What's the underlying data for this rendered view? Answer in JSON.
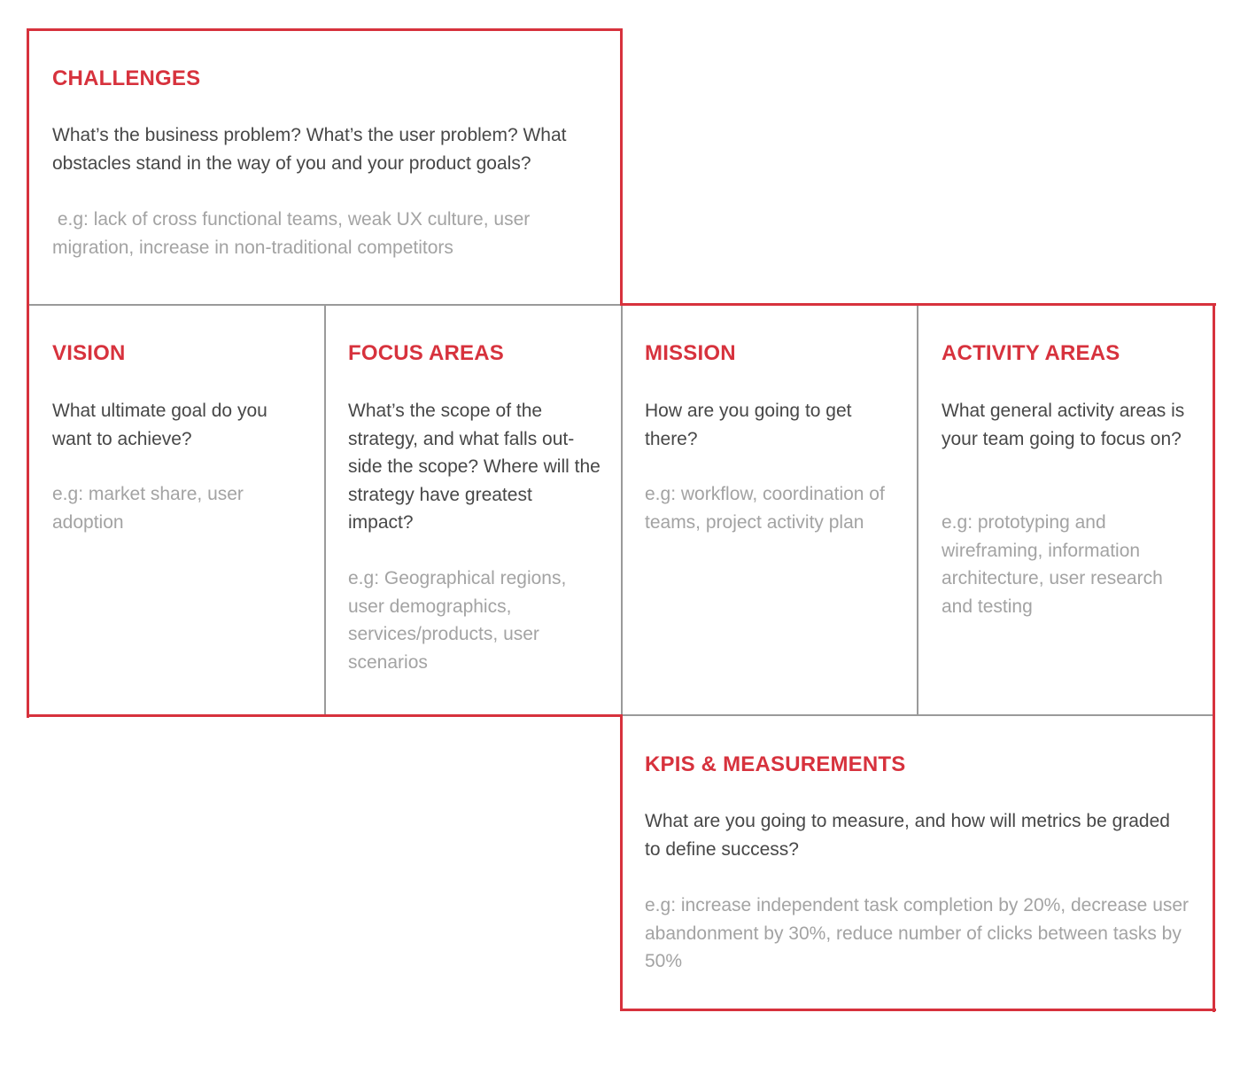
{
  "canvas": {
    "colors": {
      "accent_red": "#d7323d",
      "divider_gray": "#9a9a9a",
      "question_text": "#474747",
      "example_text": "#a3a3a3"
    },
    "sections": {
      "challenges": {
        "title": "CHALLENGES",
        "question": "What’s the business problem? What’s the user problem? What obstacles stand in the way of you and your product goals?",
        "example": " e.g: lack of cross functional teams, weak UX culture, user migration, increase in non-traditional competitors"
      },
      "vision": {
        "title": "VISION",
        "question": "What ultimate goal do you want to achieve?",
        "example": "e.g: market share, user adoption"
      },
      "focus_areas": {
        "title": "FOCUS AREAS",
        "question": "What’s the scope of the strategy, and what falls out-side the scope? Where will the strategy have greatest impact?",
        "example": "e.g: Geographical regions, user demographics, services/products, user scenarios"
      },
      "mission": {
        "title": "MISSION",
        "question": "How are you going to get there?",
        "example": "e.g: workflow, coordination of teams, project activity plan"
      },
      "activity_areas": {
        "title": "ACTIVITY AREAS",
        "question": "What general activity areas is your team going to focus on?",
        "example": "e.g: prototyping and wireframing, information architecture, user research and testing"
      },
      "kpis": {
        "title": "KPIS & MEASUREMENTS",
        "question": "What are you going to measure, and how will metrics be graded to define success?",
        "example": "e.g: increase independent task completion by 20%, decrease user abandonment by 30%, reduce number of clicks between tasks by 50%"
      }
    }
  }
}
